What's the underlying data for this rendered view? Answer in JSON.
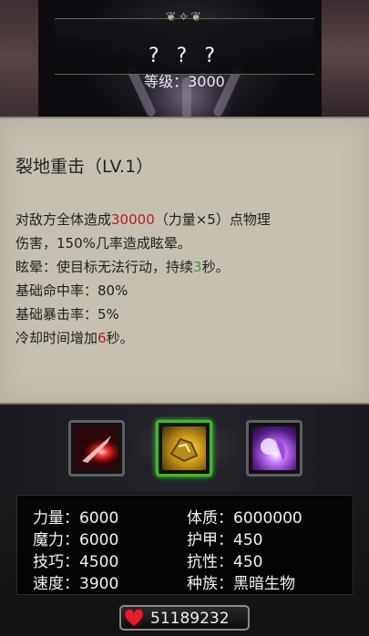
{
  "monster": {
    "name": "? ? ?",
    "level_text": "等级：3000"
  },
  "skill": {
    "title": "裂地重击（LV.1）",
    "desc_line1_pre": "对敌方全体造成",
    "desc_line1_num": "30000",
    "desc_line1_post": "（力量×5）点物理",
    "desc_line2": "伤害，150%几率造成眩晕。",
    "desc_line3_pre": "眩晕：使目标无法行动，持续",
    "desc_line3_num": "3",
    "desc_line3_post": "秒。",
    "hit_rate": "基础命中率：80%",
    "crit_rate": "基础暴击率：5%",
    "cooldown_pre": "冷却时间增加",
    "cooldown_num": "6",
    "cooldown_post": "秒。"
  },
  "skill_slots": [
    {
      "icon": "red-slash-icon",
      "selected": false
    },
    {
      "icon": "gold-rock-smash-icon",
      "selected": true
    },
    {
      "icon": "purple-orb-icon",
      "selected": false
    }
  ],
  "stats": {
    "strength": "力量：6000",
    "magic": "魔力：6000",
    "skill": "技巧：4500",
    "speed": "速度：3900",
    "constitution": "体质：6000000",
    "armor": "护甲：450",
    "resistance": "抗性：450",
    "race": "种族：黑暗生物"
  },
  "hp": {
    "value": "51189232"
  },
  "colors": {
    "highlight_red": "#b01c1c",
    "highlight_green": "#3a9a2a",
    "selected_frame": "#39c026"
  }
}
